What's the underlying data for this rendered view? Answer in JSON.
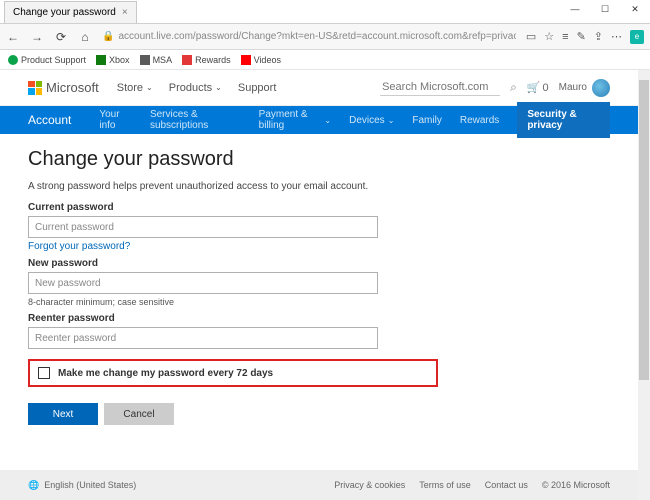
{
  "window": {
    "tab_title": "Change your password",
    "url": "account.live.com/password/Change?mkt=en-US&retd=account.microsoft.com&refp=privacy"
  },
  "favorites": [
    "Product Support",
    "Xbox",
    "MSA",
    "Rewards",
    "Videos"
  ],
  "ms_header": {
    "brand": "Microsoft",
    "nav": {
      "store": "Store",
      "products": "Products",
      "support": "Support"
    },
    "search_placeholder": "Search Microsoft.com",
    "cart_count": "0",
    "user_name": "Mauro"
  },
  "account_nav": {
    "brand": "Account",
    "items": {
      "your_info": "Your info",
      "services": "Services & subscriptions",
      "payment": "Payment & billing",
      "devices": "Devices",
      "family": "Family",
      "rewards": "Rewards",
      "security": "Security & privacy"
    }
  },
  "form": {
    "title": "Change your password",
    "subtitle": "A strong password helps prevent unauthorized access to your email account.",
    "current_label": "Current password",
    "current_placeholder": "Current password",
    "forgot_link": "Forgot your password?",
    "new_label": "New password",
    "new_placeholder": "New password",
    "hint": "8-character minimum; case sensitive",
    "reenter_label": "Reenter password",
    "reenter_placeholder": "Reenter password",
    "checkbox_label": "Make me change my password every 72 days",
    "next": "Next",
    "cancel": "Cancel"
  },
  "footer": {
    "lang": "English (United States)",
    "privacy": "Privacy & cookies",
    "terms": "Terms of use",
    "contact": "Contact us",
    "copyright": "© 2016 Microsoft"
  }
}
